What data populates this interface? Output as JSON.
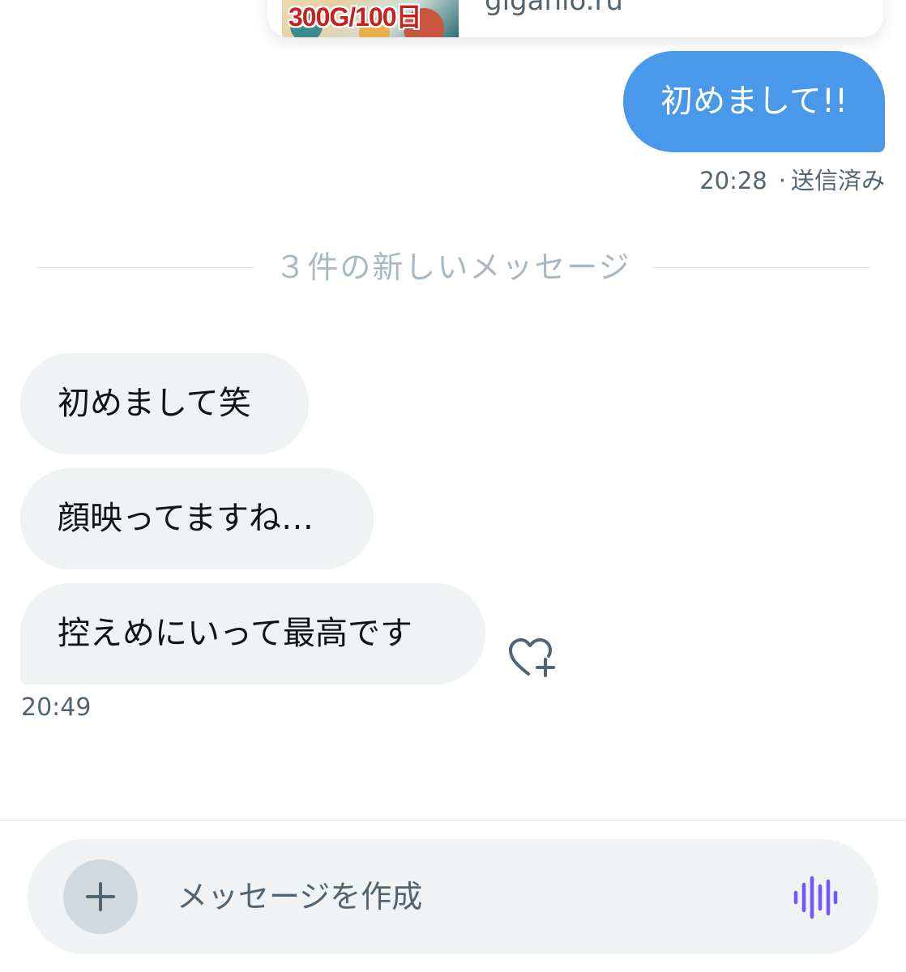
{
  "link_preview": {
    "badge": "300G/100日",
    "domain": "giganio.ru"
  },
  "sent": {
    "text": "初めまして!!",
    "time": "20:28",
    "separator": "·",
    "status": "送信済み",
    "bubble_color": "#4a98e9"
  },
  "divider": {
    "label": "３件の新しいメッセージ"
  },
  "received": {
    "messages": [
      {
        "text": "初めまして笑"
      },
      {
        "text": "顔映ってますね…"
      },
      {
        "text": "控えめにいって最高です"
      }
    ],
    "time": "20:49",
    "reaction_icon": "heart-plus-icon"
  },
  "composer": {
    "placeholder": "メッセージを作成",
    "add_icon": "plus-icon",
    "voice_icon": "voice-waveform-icon",
    "accent_color": "#7856ff"
  }
}
